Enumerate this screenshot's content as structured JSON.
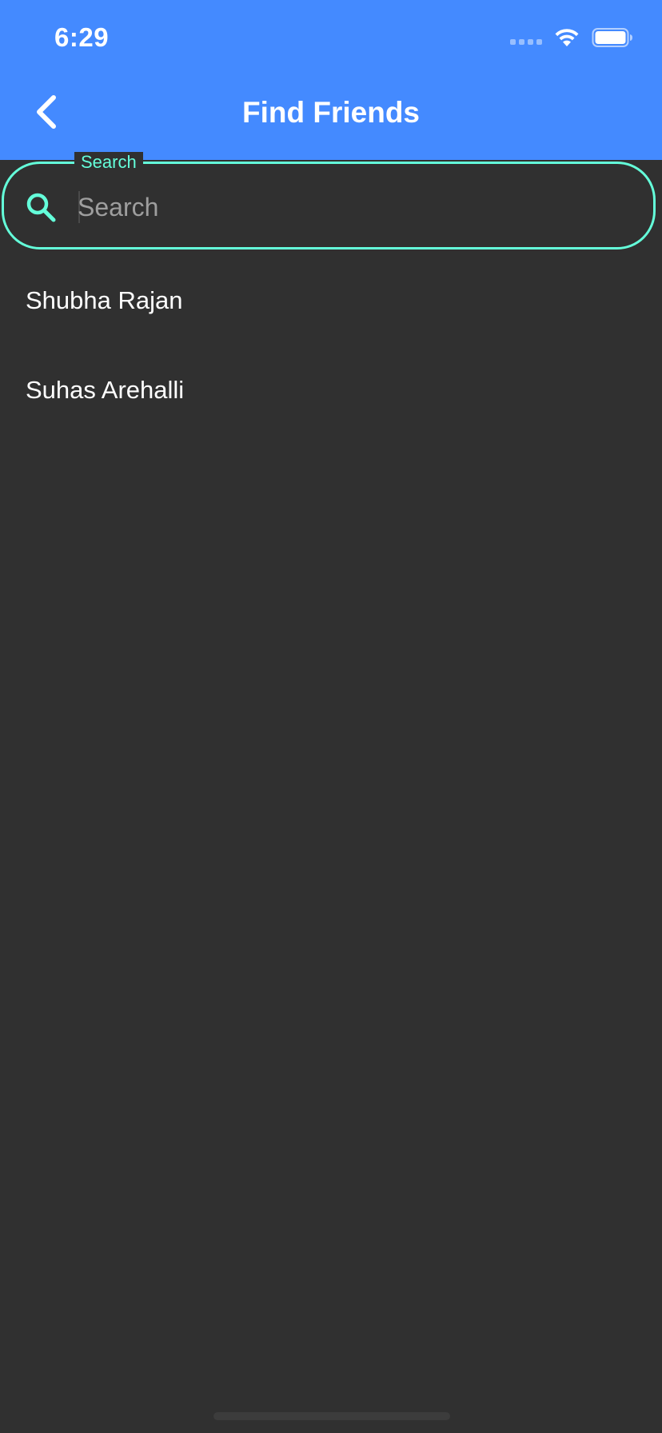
{
  "status_bar": {
    "time": "6:29",
    "signal_icon": "signal-icon",
    "wifi_icon": "wifi-icon",
    "battery_icon": "battery-icon"
  },
  "app_bar": {
    "title": "Find Friends",
    "back_icon": "chevron-left-icon",
    "background_color": "#448AFF"
  },
  "search": {
    "label": "Search",
    "placeholder": "Search",
    "value": "",
    "icon": "search-icon",
    "accent_color": "#64FFDA"
  },
  "friends": [
    {
      "name": "Shubha Rajan"
    },
    {
      "name": "Suhas Arehalli"
    }
  ]
}
